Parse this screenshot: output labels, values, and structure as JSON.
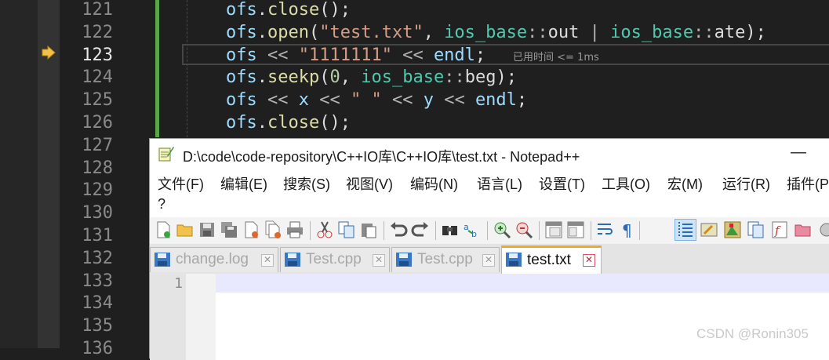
{
  "editor": {
    "line_numbers": [
      "121",
      "122",
      "123",
      "124",
      "125",
      "126",
      "127",
      "128",
      "129",
      "130",
      "131",
      "132",
      "133",
      "134",
      "135",
      "136"
    ],
    "current_line": "123",
    "code_lines": [
      [
        {
          "t": "ofs",
          "c": "k-var"
        },
        {
          "t": ".",
          "c": "k-plain"
        },
        {
          "t": "close",
          "c": "k-fn"
        },
        {
          "t": "();",
          "c": "k-plain"
        }
      ],
      [
        {
          "t": "ofs",
          "c": "k-var"
        },
        {
          "t": ".",
          "c": "k-plain"
        },
        {
          "t": "open",
          "c": "k-fn"
        },
        {
          "t": "(",
          "c": "k-plain"
        },
        {
          "t": "\"test.txt\"",
          "c": "k-str"
        },
        {
          "t": ", ",
          "c": "k-plain"
        },
        {
          "t": "ios_base",
          "c": "k-type"
        },
        {
          "t": "::",
          "c": "k-op"
        },
        {
          "t": "out",
          "c": "k-plain"
        },
        {
          "t": " | ",
          "c": "k-op"
        },
        {
          "t": "ios_base",
          "c": "k-type"
        },
        {
          "t": "::",
          "c": "k-op"
        },
        {
          "t": "ate",
          "c": "k-plain"
        },
        {
          "t": ");",
          "c": "k-plain"
        }
      ],
      [
        {
          "t": "ofs",
          "c": "k-var"
        },
        {
          "t": " << ",
          "c": "k-op"
        },
        {
          "t": "\"1111111\"",
          "c": "k-str"
        },
        {
          "t": " << ",
          "c": "k-op"
        },
        {
          "t": "endl",
          "c": "k-var"
        },
        {
          "t": ";",
          "c": "k-plain"
        }
      ],
      [
        {
          "t": "ofs",
          "c": "k-var"
        },
        {
          "t": ".",
          "c": "k-plain"
        },
        {
          "t": "seekp",
          "c": "k-fn"
        },
        {
          "t": "(",
          "c": "k-plain"
        },
        {
          "t": "0",
          "c": "k-num"
        },
        {
          "t": ", ",
          "c": "k-plain"
        },
        {
          "t": "ios_base",
          "c": "k-type"
        },
        {
          "t": "::",
          "c": "k-op"
        },
        {
          "t": "beg",
          "c": "k-plain"
        },
        {
          "t": ");",
          "c": "k-plain"
        }
      ],
      [
        {
          "t": "ofs",
          "c": "k-var"
        },
        {
          "t": " << ",
          "c": "k-op"
        },
        {
          "t": "x",
          "c": "k-var"
        },
        {
          "t": " << ",
          "c": "k-op"
        },
        {
          "t": "\" \"",
          "c": "k-str"
        },
        {
          "t": " << ",
          "c": "k-op"
        },
        {
          "t": "y",
          "c": "k-var"
        },
        {
          "t": " << ",
          "c": "k-op"
        },
        {
          "t": "endl",
          "c": "k-var"
        },
        {
          "t": ";",
          "c": "k-plain"
        }
      ],
      [
        {
          "t": "ofs",
          "c": "k-var"
        },
        {
          "t": ".",
          "c": "k-plain"
        },
        {
          "t": "close",
          "c": "k-fn"
        },
        {
          "t": "();",
          "c": "k-plain"
        }
      ]
    ],
    "elapsed_hint": "已用时间 <= 1ms",
    "colors": {
      "change_bar": "#57a64a",
      "string": "#d69d85",
      "type": "#4ec9b0",
      "function": "#dcdcaa",
      "variable": "#9cdcfe"
    }
  },
  "notepad": {
    "title": "D:\\code\\code-repository\\C++IO库\\C++IO库\\test.txt - Notepad++",
    "minimize_label": "—",
    "menu": [
      "文件(F)",
      "编辑(E)",
      "搜索(S)",
      "视图(V)",
      "编码(N)",
      "语言(L)",
      "设置(T)",
      "工具(O)",
      "宏(M)",
      "运行(R)",
      "插件(P)"
    ],
    "help_menu": "?",
    "tabs": [
      {
        "label": "change.log",
        "icon": "save-disk-icon",
        "active": false
      },
      {
        "label": "Test.cpp",
        "icon": "save-disk-icon",
        "active": false
      },
      {
        "label": "Test.cpp",
        "icon": "save-disk-icon",
        "active": false
      },
      {
        "label": "test.txt",
        "icon": "save-disk-icon",
        "active": true
      }
    ],
    "tab_close_label": "✕",
    "gutter_line": "1",
    "accent_tab_color": "#f5a623"
  },
  "watermark": "CSDN @Ronin305"
}
